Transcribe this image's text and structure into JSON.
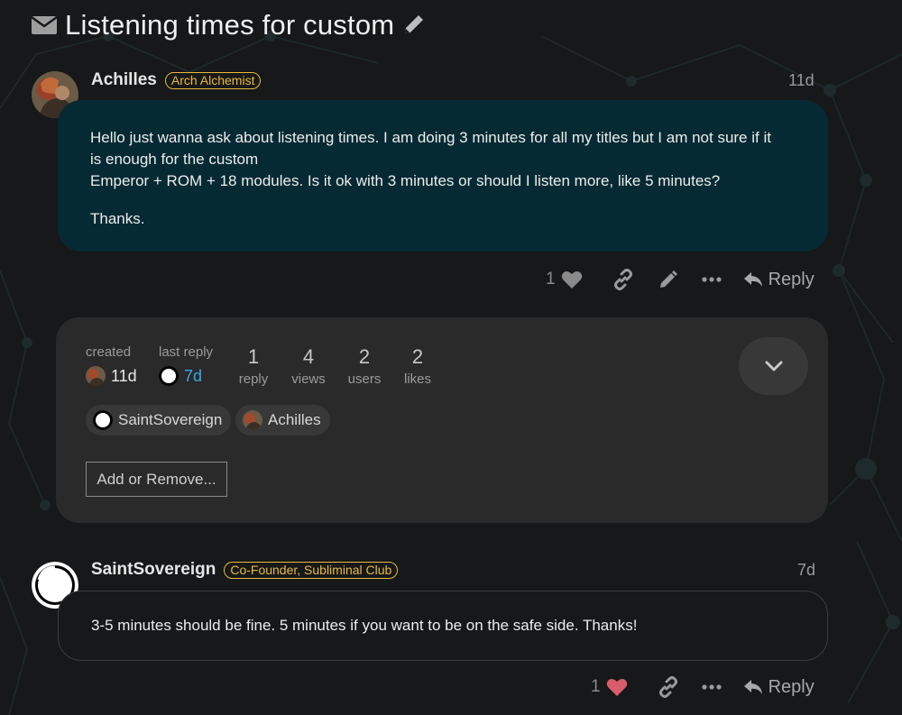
{
  "topic": {
    "title": "Listening times for custom",
    "title_icon": "envelope-icon",
    "edit_icon": "pencil-icon"
  },
  "colors": {
    "background": "#161819",
    "post_bubble": "#062a34",
    "badge": "#e9b93b",
    "like_active": "#d95d6a",
    "link_blue": "#3aa7e0",
    "topic_map": "#2a2a2a"
  },
  "posts": [
    {
      "author": "Achilles",
      "badge": "Arch Alchemist",
      "date": "11d",
      "lines": [
        "Hello just wanna ask about listening times. I am doing 3 minutes for all my titles but I am not sure if it",
        "is enough for the custom",
        "Emperor + ROM + 18 modules. Is it ok with 3 minutes or should I listen more, like 5 minutes?"
      ],
      "closing": "Thanks.",
      "likes": "1",
      "reply_label": "Reply"
    },
    {
      "author": "SaintSovereign",
      "badge": "Co-Founder, Subliminal Club",
      "date": "7d",
      "text": "3-5 minutes should be fine. 5 minutes if you want to be on the safe side. Thanks!",
      "likes": "1",
      "reply_label": "Reply"
    }
  ],
  "topic_map": {
    "created_label": "created",
    "created_value": "11d",
    "last_reply_label": "last reply",
    "last_reply_value": "7d",
    "stats": [
      {
        "num": "1",
        "label": "reply"
      },
      {
        "num": "4",
        "label": "views"
      },
      {
        "num": "2",
        "label": "users"
      },
      {
        "num": "2",
        "label": "likes"
      }
    ],
    "participants": [
      "SaintSovereign",
      "Achilles"
    ],
    "add_button": "Add or Remove..."
  }
}
